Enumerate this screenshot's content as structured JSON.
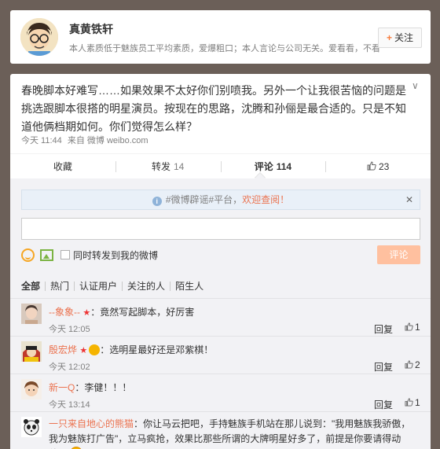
{
  "profile": {
    "name": "真黄铁轩",
    "bio": "本人素质低于魅族员工平均素质，爱爆粗口；本人言论与公司无关。爱看看，不看",
    "follow_label": "关注"
  },
  "post": {
    "text": "春晚脚本好难写……如果效果不太好你们别喷我。另外一个让我很苦恼的问题是挑选跟脚本很搭的明星演员。按现在的思路，沈腾和孙俪是最合适的。只是不知道他俩档期如何。你们觉得怎么样？",
    "time": "今天 11:44",
    "source_prefix": "来自",
    "source": "微博 weibo.com"
  },
  "actions": {
    "favorite": "收藏",
    "repost": "转发",
    "repost_count": "14",
    "comment": "评论",
    "comment_count": "114",
    "like_count": "23"
  },
  "notice": {
    "text": "#微博辟谣#平台，",
    "link": "欢迎查阅！"
  },
  "composer": {
    "also_repost": "同时转发到我的微博",
    "submit": "评论"
  },
  "filters": [
    "全部",
    "热门",
    "认证用户",
    "关注的人",
    "陌生人"
  ],
  "comments": [
    {
      "user": "--象象--",
      "text": "：竟然写起脚本，好厉害",
      "time": "今天 12:05",
      "reply": "回复",
      "likes": "1"
    },
    {
      "user": "殷宏烨",
      "text": "：选明星最好还是邓紫棋！",
      "time": "今天 12:02",
      "reply": "回复",
      "likes": "2"
    },
    {
      "user": "新一Q",
      "text": "：李健！！！",
      "time": "今天 13:14",
      "reply": "回复",
      "likes": "1"
    },
    {
      "user": "一只来自地心的熊猫",
      "text": "：你让马云把吧，手持魅族手机站在那儿说到：\"我用魅族我骄傲，我为魅族打广告\"，立马疯抢，效果比那些所谓的大牌明星好多了，前提是你要请得动他。"
    }
  ],
  "colors": {
    "accent": "#eb7350",
    "background": "#6b5f58",
    "comment_bg": "#f2f2f5"
  }
}
